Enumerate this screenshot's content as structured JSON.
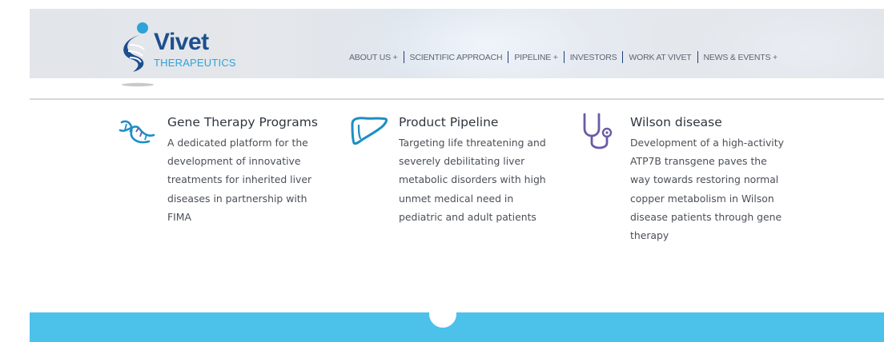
{
  "logo": {
    "word": "Vivet",
    "sub": "THERAPEUTICS"
  },
  "nav": {
    "items": [
      {
        "label": "ABOUT US +"
      },
      {
        "label": "SCIENTIFIC APPROACH"
      },
      {
        "label": "PIPELINE +"
      },
      {
        "label": "INVESTORS"
      },
      {
        "label": "WORK AT VIVET"
      },
      {
        "label": "NEWS & EVENTS +"
      }
    ]
  },
  "features": [
    {
      "icon": "dna-icon",
      "title": "Gene Therapy Programs",
      "body": "A dedicated platform for the development of innovative treatments for inherited liver diseases in partnership with FIMA"
    },
    {
      "icon": "liver-icon",
      "title": "Product Pipeline",
      "body": "Targeting life threatening and severely debilitating liver metabolic disorders with high unmet medical need in pediatric and adult patients"
    },
    {
      "icon": "stethoscope-icon",
      "title": "Wilson disease",
      "body": "Development of a high-activity ATP7B transgene paves the way towards restoring normal copper metabolism in Wilson disease patients through gene therapy"
    }
  ],
  "colors": {
    "brand_blue": "#1d4e8f",
    "accent_cyan": "#2ea3d9",
    "icon_blue": "#1c8fc4",
    "icon_purple": "#6b5aa6",
    "band_cyan": "#4cc1ea"
  }
}
